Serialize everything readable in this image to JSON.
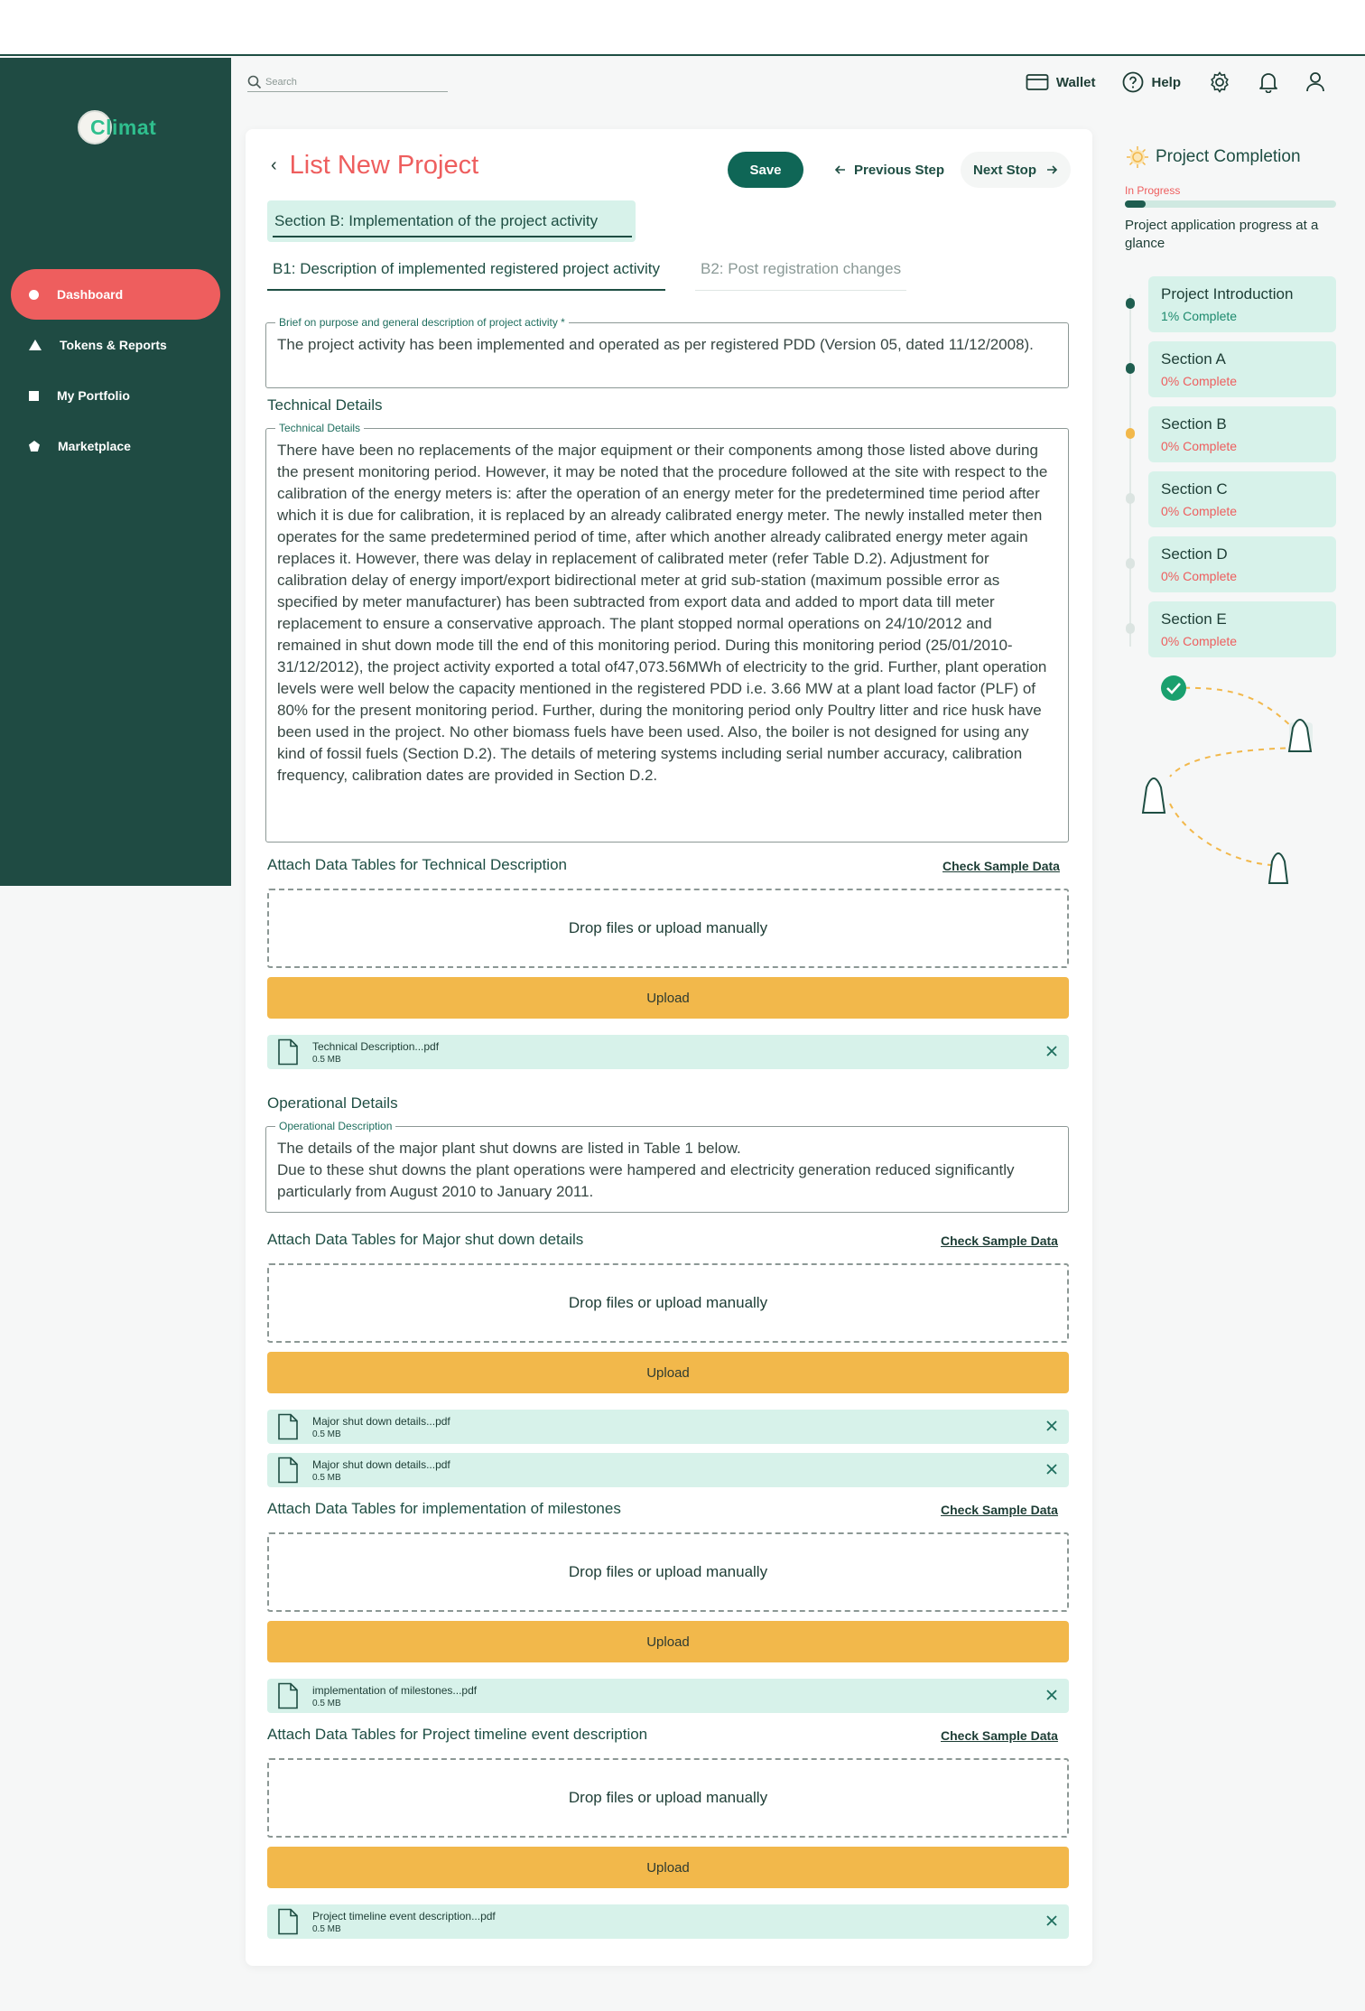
{
  "app": {
    "logo_text": "Climat"
  },
  "sidebar": {
    "items": [
      {
        "label": "Dashboard",
        "icon": "dot-icon",
        "active": true
      },
      {
        "label": "Tokens & Reports",
        "icon": "triangle-icon",
        "active": false
      },
      {
        "label": "My Portfolio",
        "icon": "square-icon",
        "active": false
      },
      {
        "label": "Marketplace",
        "icon": "pentagon-icon",
        "active": false
      }
    ]
  },
  "header": {
    "search_placeholder": "Search",
    "wallet_label": "Wallet",
    "help_label": "Help"
  },
  "page": {
    "title": "List New Project",
    "save_label": "Save",
    "prev_label": "Previous Step",
    "next_label": "Next Stop",
    "section_label": "Section B: Implementation of the project activity",
    "tabs": [
      {
        "label": "B1: Description of implemented registered project activity",
        "active": true
      },
      {
        "label": "B2: Post registration changes",
        "active": false
      }
    ],
    "brief": {
      "legend": "Brief on purpose and general description of project activity *",
      "text": "The project activity has been implemented and operated as per registered PDD (Version 05, dated 11/12/2008)."
    },
    "technical_heading": "Technical Details",
    "technical": {
      "legend": "Technical Details",
      "text": "There have been no replacements of the major equipment or their components among those listed above during the present monitoring period. However, it may be noted that the procedure followed at the site with respect to the calibration of the energy meters is: after the operation of an energy meter for the predetermined time period after which it is due for calibration, it is replaced by an already calibrated energy meter. The newly installed meter then operates for the same predetermined period of time, after which another already calibrated energy meter again replaces it. However, there was delay in replacement of calibrated meter (refer Table D.2). Adjustment for calibration delay of energy import/export bidirectional meter at grid sub-station (maximum possible error as specified by meter manufacturer) has been subtracted from export data and added to mport data till meter replacement to ensure a conservative approach. The plant stopped normal operations on 24/10/2012 and remained in shut down mode till the end of this monitoring period. During this monitoring period (25/01/2010-31/12/2012), the project activity exported a total of47,073.56MWh of electricity to the grid. Further, plant operation levels were well below the capacity mentioned in the registered PDD i.e. 3.66 MW at a plant load factor (PLF) of 80% for the present monitoring period. Further, during the monitoring period only Poultry litter and rice husk have been used in the project. No other biomass fuels have been used. Also, the boiler is not designed for using any kind of fossil fuels (Section D.2). The details of metering systems including serial number accuracy, calibration frequency, calibration dates are provided in Section D.2."
    },
    "operational_heading": "Operational Details",
    "operational": {
      "legend": "Operational Description",
      "text": "The details of the major plant shut downs are listed in Table 1 below.\nDue to these shut downs the plant operations were hampered and electricity generation reduced significantly particularly from August 2010 to January 2011."
    },
    "check_label": "Check Sample Data",
    "drop_label": "Drop files or upload manually",
    "upload_label": "Upload",
    "attachments": [
      {
        "title": "Attach Data Tables for Technical Description",
        "files": [
          {
            "name": "Technical Description...pdf",
            "size": "0.5 MB"
          }
        ]
      },
      {
        "title": "Attach Data Tables for  Major shut down details",
        "files": [
          {
            "name": "Major shut down details...pdf",
            "size": "0.5 MB"
          },
          {
            "name": "Major shut down details...pdf",
            "size": "0.5 MB"
          }
        ]
      },
      {
        "title": "Attach Data Tables for  implementation of milestones",
        "files": [
          {
            "name": "implementation of milestones...pdf",
            "size": "0.5 MB"
          }
        ]
      },
      {
        "title": "Attach Data Tables for  Project timeline event description",
        "files": [
          {
            "name": "Project timeline event description...pdf",
            "size": "0.5 MB"
          }
        ]
      }
    ]
  },
  "completion": {
    "title": "Project Completion",
    "status": "In Progress",
    "progress": 0.1,
    "description": "Project application progress at a glance",
    "steps": [
      {
        "name": "Project Introduction",
        "progress": "1% Complete",
        "state": "done"
      },
      {
        "name": "Section A",
        "progress": "0% Complete",
        "state": "done"
      },
      {
        "name": "Section B",
        "progress": "0% Complete",
        "state": "current"
      },
      {
        "name": "Section C",
        "progress": "0% Complete",
        "state": "pending"
      },
      {
        "name": "Section D",
        "progress": "0% Complete",
        "state": "pending"
      },
      {
        "name": "Section E",
        "progress": "0% Complete",
        "state": "pending"
      }
    ]
  },
  "colors": {
    "brand_green": "#1f4b43",
    "accent_red": "#ee5e5e",
    "upload_yellow": "#f2b84b",
    "mint": "#d7f2ea",
    "intro_progress_green": "#1e8a6e"
  }
}
